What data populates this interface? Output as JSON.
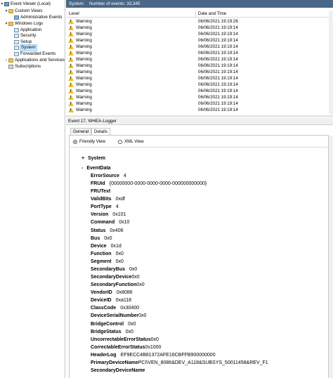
{
  "tree": {
    "items": [
      {
        "label": "Event Viewer (Local)",
        "icon": "event-viewer-icon",
        "caret": "▾"
      },
      {
        "label": "Custom Views",
        "icon": "folder-icon",
        "caret": "▾"
      },
      {
        "label": "Administrative Events",
        "icon": "filter-view-icon",
        "caret": ""
      },
      {
        "label": "Windows Logs",
        "icon": "folder-icon",
        "caret": "▾"
      },
      {
        "label": "Application",
        "icon": "log-icon",
        "caret": ""
      },
      {
        "label": "Security",
        "icon": "log-icon",
        "caret": ""
      },
      {
        "label": "Setup",
        "icon": "log-icon",
        "caret": ""
      },
      {
        "label": "System",
        "icon": "log-icon",
        "caret": ""
      },
      {
        "label": "Forwarded Events",
        "icon": "log-icon",
        "caret": ""
      },
      {
        "label": "Applications and Services Lo",
        "icon": "folder-icon",
        "caret": "›"
      },
      {
        "label": "Subscriptions",
        "icon": "subscriptions-icon",
        "caret": ""
      }
    ]
  },
  "grid": {
    "log_name": "System",
    "event_count": "Number of events: 33,345",
    "col_level": "Level",
    "col_date": "Date and Time",
    "rows": [
      {
        "level": "Warning",
        "date": "06/06/2021 19:19:26"
      },
      {
        "level": "Warning",
        "date": "06/06/2021 19:19:14"
      },
      {
        "level": "Warning",
        "date": "06/06/2021 19:19:14"
      },
      {
        "level": "Warning",
        "date": "06/06/2021 19:19:14"
      },
      {
        "level": "Warning",
        "date": "06/06/2021 19:19:14"
      },
      {
        "level": "Warning",
        "date": "06/06/2021 19:19:14"
      },
      {
        "level": "Warning",
        "date": "06/06/2021 19:19:14"
      },
      {
        "level": "Warning",
        "date": "06/06/2021 19:19:14"
      },
      {
        "level": "Warning",
        "date": "06/06/2021 19:19:14"
      },
      {
        "level": "Warning",
        "date": "06/06/2021 19:19:14"
      },
      {
        "level": "Warning",
        "date": "06/06/2021 19:19:14"
      },
      {
        "level": "Warning",
        "date": "06/06/2021 19:19:14"
      },
      {
        "level": "Warning",
        "date": "06/06/2021 19:19:14"
      },
      {
        "level": "Warning",
        "date": "06/06/2021 19:19:14"
      },
      {
        "level": "Warning",
        "date": "06/06/2021 19:19:14"
      }
    ]
  },
  "event": {
    "title": "Event 17, WHEA-Logger",
    "tab_general": "General",
    "tab_details": "Details",
    "view_friendly": "Friendly View",
    "view_xml": "XML View",
    "group_system": "System",
    "group_eventdata": "EventData",
    "sign_plus": "+",
    "sign_minus": "-",
    "fields": [
      {
        "k": "ErrorSource",
        "v": "4",
        "gap": 1
      },
      {
        "k": "FRUId",
        "v": "{00000000-0000-0000-0000-000000000000}",
        "gap": 1
      },
      {
        "k": "FRUText",
        "v": "",
        "gap": 0
      },
      {
        "k": "ValidBits",
        "v": "0xdf",
        "gap": 1
      },
      {
        "k": "PortType",
        "v": "4",
        "gap": 1
      },
      {
        "k": "Version",
        "v": "0x101",
        "gap": 1
      },
      {
        "k": "Command",
        "v": "0x10",
        "gap": 1
      },
      {
        "k": "Status",
        "v": "0x406",
        "gap": 1
      },
      {
        "k": "Bus",
        "v": "0x0",
        "gap": 1
      },
      {
        "k": "Device",
        "v": "0x1d",
        "gap": 1
      },
      {
        "k": "Function",
        "v": "0x0",
        "gap": 1
      },
      {
        "k": "Segment",
        "v": "0x0",
        "gap": 1
      },
      {
        "k": "SecondaryBus",
        "v": "0x0",
        "gap": 1
      },
      {
        "k": "SecondaryDevice",
        "v": "0x0",
        "gap": 0
      },
      {
        "k": "SecondaryFunction",
        "v": "0x0",
        "gap": 0
      },
      {
        "k": "VendorID",
        "v": "0x8086",
        "gap": 1
      },
      {
        "k": "DeviceID",
        "v": "0xa118",
        "gap": 1
      },
      {
        "k": "ClassCode",
        "v": "0x30400",
        "gap": 1
      },
      {
        "k": "DeviceSerialNumber",
        "v": "0x0",
        "gap": 0
      },
      {
        "k": "BridgeControl",
        "v": "0x0",
        "gap": 1
      },
      {
        "k": "BridgeStatus",
        "v": "0x0",
        "gap": 1
      },
      {
        "k": "UncorrectableErrorStatus",
        "v": "0x0",
        "gap": 0
      },
      {
        "k": "CorrectableErrorStatus",
        "v": "0x1000",
        "gap": 0
      },
      {
        "k": "HeaderLog",
        "v": "EF9ECC4B81372AFE16CBFFB900000000",
        "gap": 1
      },
      {
        "k": "PrimaryDeviceName",
        "v": "PCI\\VEN_8086&DEV_A118&SUBSYS_50011458&REV_F1",
        "gap": 0
      },
      {
        "k": "SecondaryDeviceName",
        "v": "",
        "gap": 0
      }
    ]
  },
  "colors": {
    "title_bar": "#4a6787",
    "selection": "#cce8ff",
    "warning": "#f2c21b"
  }
}
